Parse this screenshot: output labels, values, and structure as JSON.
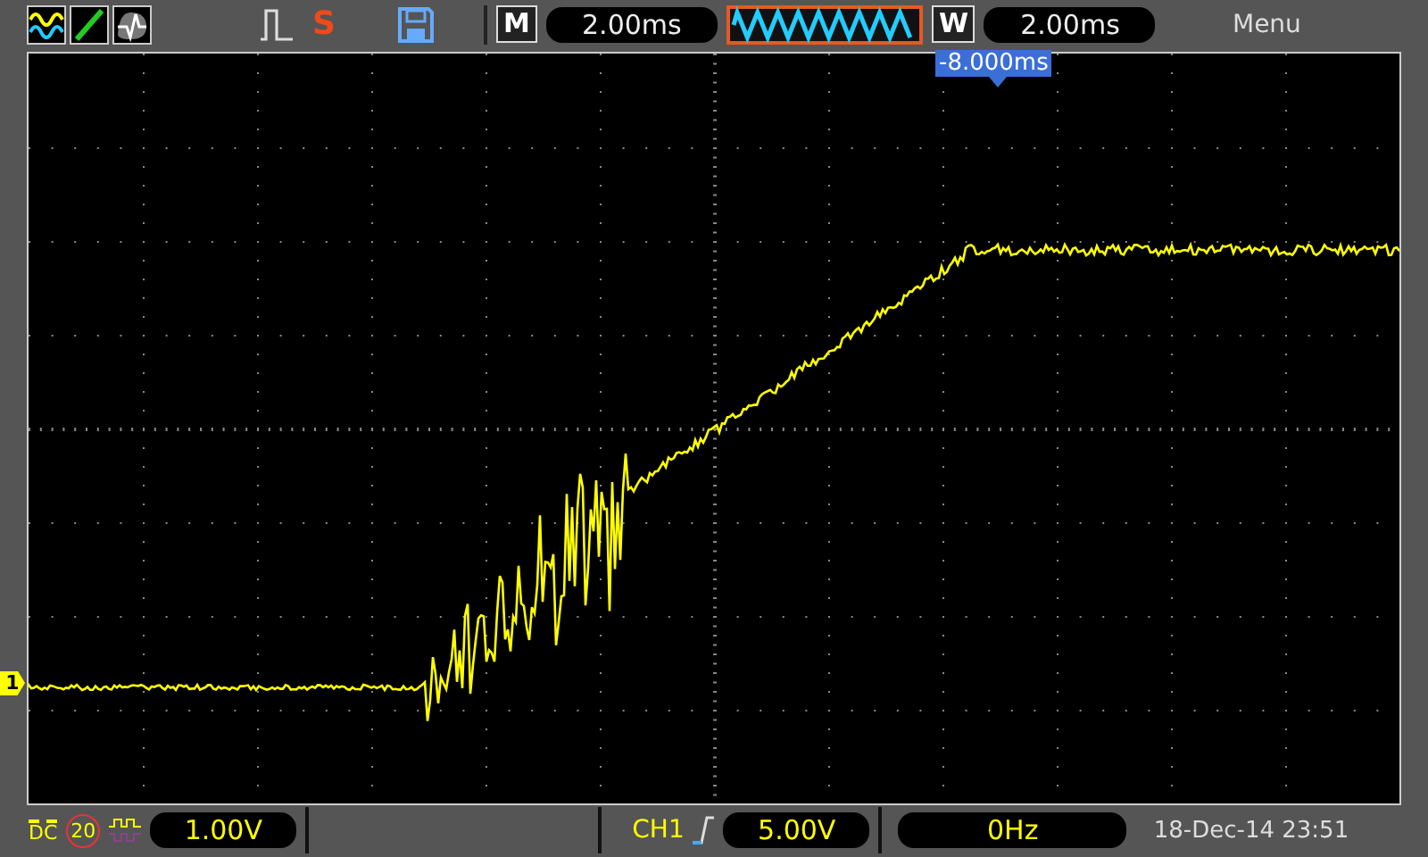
{
  "toolbar": {
    "run_status": "S",
    "main_label": "M",
    "main_timebase": "2.00ms",
    "window_label": "W",
    "window_timebase": "2.00ms",
    "menu": "Menu"
  },
  "trigger_position": "-8.000ms",
  "channel_marker": "1",
  "bottom_bar": {
    "coupling": "DC",
    "bandwidth_limit": "20",
    "volts_per_div": "1.00V",
    "trigger_source": "CH1",
    "trigger_level": "5.00V",
    "frequency": "0Hz",
    "datetime": "18-Dec-14 23:51"
  }
}
